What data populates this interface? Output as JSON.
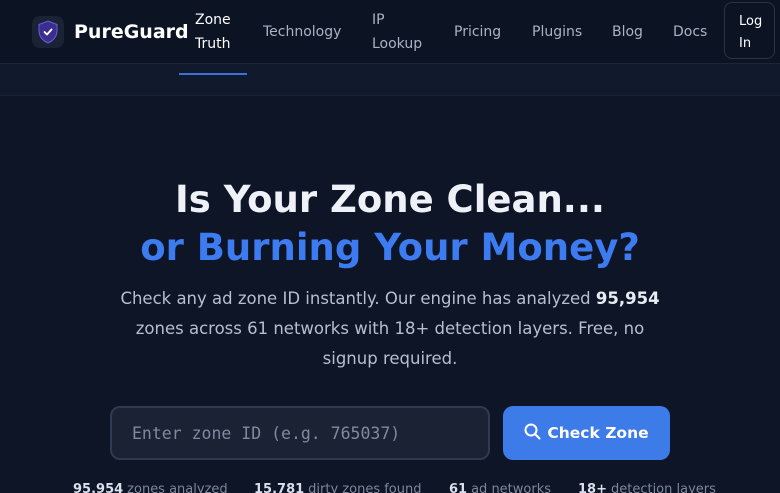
{
  "brand": {
    "name": "PureGuard",
    "logo_icon": "shield-check-icon",
    "accent": "#3d7be8"
  },
  "nav": {
    "items": [
      {
        "label": "Zone Truth",
        "active": true
      },
      {
        "label": "Technology"
      },
      {
        "label": "IP Lookup"
      },
      {
        "label": "Pricing"
      },
      {
        "label": "Plugins"
      },
      {
        "label": "Blog"
      },
      {
        "label": "Docs"
      }
    ],
    "login_label": "Log In"
  },
  "hero": {
    "title_line1": "Is Your Zone Clean...",
    "title_line2": "or Burning Your Money?",
    "desc_prefix": "Check any ad zone ID instantly. Our engine has analyzed",
    "desc_count": "95,954",
    "desc_suffix": "zones across 61 networks with 18+ detection layers. Free, no signup required."
  },
  "search": {
    "placeholder": "Enter zone ID (e.g. 765037)",
    "value": "",
    "button_label": "Check Zone",
    "button_icon": "search-icon"
  },
  "stats": [
    {
      "value": "95,954",
      "label": "zones analyzed"
    },
    {
      "value": "15,781",
      "label": "dirty zones found"
    },
    {
      "value": "61",
      "label": "ad networks"
    },
    {
      "value": "18+",
      "label": "detection layers"
    }
  ]
}
